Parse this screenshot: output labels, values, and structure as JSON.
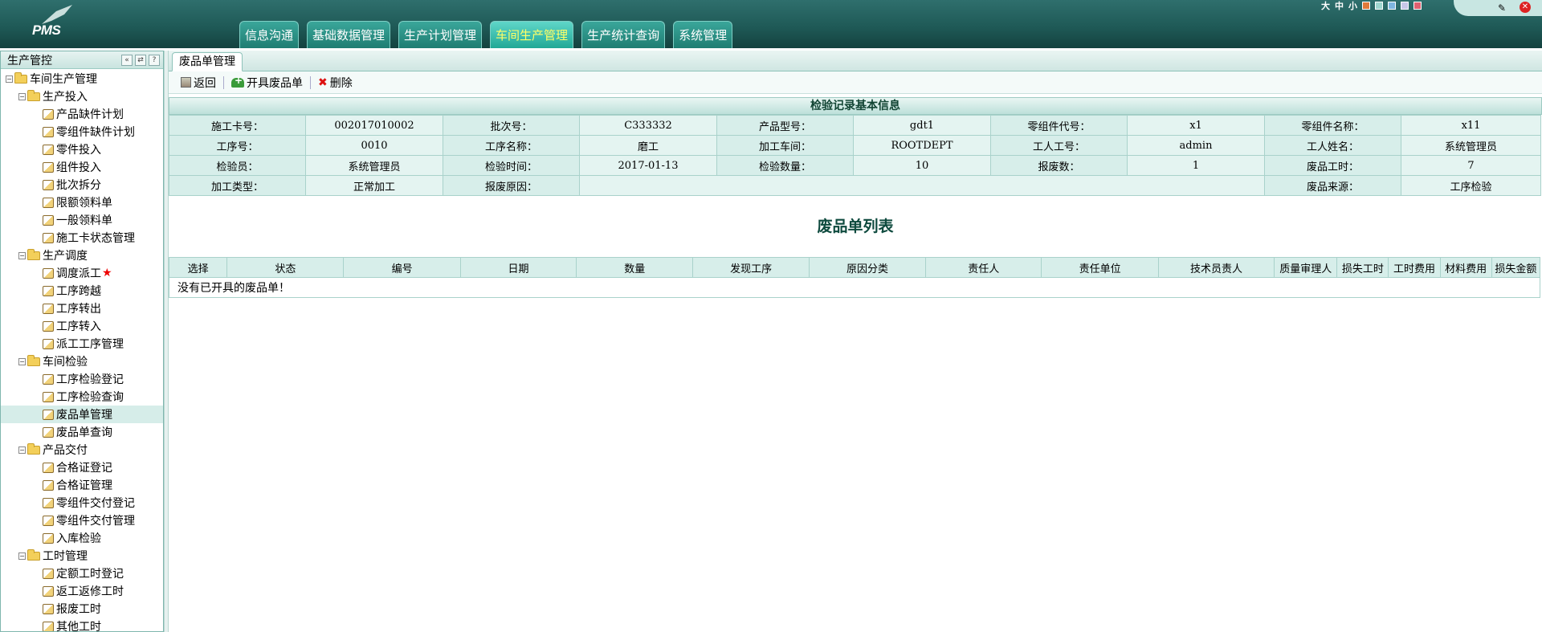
{
  "header": {
    "logo_text": "PMS",
    "nav": [
      "信息沟通",
      "基础数据管理",
      "生产计划管理",
      "车间生产管理",
      "生产统计查询",
      "系统管理"
    ],
    "nav_active_index": 3,
    "font_size_labels": [
      "大",
      "中",
      "小"
    ],
    "skin_colors": [
      "#e07a3a",
      "#9fd6cf",
      "#7fb6e0",
      "#c8c8e8",
      "#e06070"
    ]
  },
  "sidebar": {
    "title": "生产管控",
    "tools": [
      "«",
      "⇄",
      "?"
    ],
    "root": "车间生产管理",
    "groups": [
      {
        "label": "生产投入",
        "items": [
          "产品缺件计划",
          "零组件缺件计划",
          "零件投入",
          "组件投入",
          "批次拆分",
          "限额领料单",
          "一般领料单",
          "施工卡状态管理"
        ]
      },
      {
        "label": "生产调度",
        "items": [
          "调度派工",
          "工序跨越",
          "工序转出",
          "工序转入",
          "派工工序管理"
        ],
        "starred_item": "调度派工"
      },
      {
        "label": "车间检验",
        "items": [
          "工序检验登记",
          "工序检验查询",
          "废品单管理",
          "废品单查询"
        ],
        "selected_item": "废品单管理"
      },
      {
        "label": "产品交付",
        "items": [
          "合格证登记",
          "合格证管理",
          "零组件交付登记",
          "零组件交付管理",
          "入库检验"
        ]
      },
      {
        "label": "工时管理",
        "items": [
          "定额工时登记",
          "返工返修工时",
          "报废工时",
          "其他工时"
        ]
      }
    ]
  },
  "main": {
    "tab": "废品单管理",
    "toolbar": {
      "back": "返回",
      "create": "开具废品单",
      "delete": "删除"
    },
    "info_title": "检验记录基本信息",
    "info_rows": [
      [
        [
          "施工卡号：",
          "002017010002"
        ],
        [
          "批次号：",
          "C333332"
        ],
        [
          "产品型号：",
          "gdt1"
        ],
        [
          "零组件代号：",
          "x1"
        ],
        [
          "零组件名称：",
          "x11"
        ]
      ],
      [
        [
          "工序号：",
          "0010"
        ],
        [
          "工序名称：",
          "磨工"
        ],
        [
          "加工车间：",
          "ROOTDEPT"
        ],
        [
          "工人工号：",
          "admin"
        ],
        [
          "工人姓名：",
          "系统管理员"
        ]
      ],
      [
        [
          "检验员：",
          "系统管理员"
        ],
        [
          "检验时间：",
          "2017-01-13"
        ],
        [
          "检验数量：",
          "10"
        ],
        [
          "报废数：",
          "1"
        ],
        [
          "废品工时：",
          "7"
        ]
      ]
    ],
    "info_last_row": {
      "process_type_label": "加工类型：",
      "process_type": "正常加工",
      "reason_label": "报废原因：",
      "reason": "",
      "source_label": "废品来源：",
      "source": "工序检验"
    },
    "list_title": "废品单列表",
    "list_headers": [
      "选择",
      "状态",
      "编号",
      "日期",
      "数量",
      "发现工序",
      "原因分类",
      "责任人",
      "责任单位",
      "技术员责人",
      "质量审理人",
      "损失工时",
      "工时费用",
      "材料费用",
      "损失金额"
    ],
    "empty_message": "没有已开具的废品单！"
  }
}
